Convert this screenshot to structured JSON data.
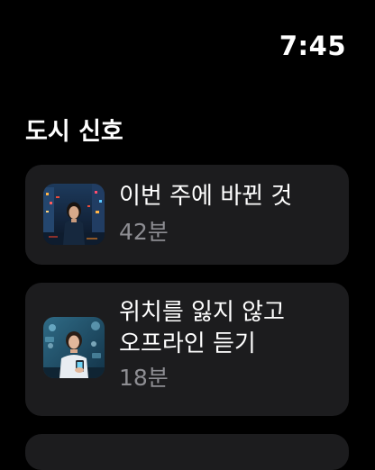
{
  "status_bar": {
    "time": "7:45"
  },
  "section": {
    "title": "도시 신호"
  },
  "episodes": [
    {
      "title_lines": [
        "이번 주에 바뀐 것"
      ],
      "duration": "42분",
      "thumbnail_icon": "city-night-person-image"
    },
    {
      "title_lines": [
        "위치를 잃지 않고",
        "오프라인 듣기"
      ],
      "duration": "18분",
      "thumbnail_icon": "person-with-phone-image"
    }
  ],
  "colors": {
    "background": "#000000",
    "card": "#1c1c1e",
    "primary_text": "#ffffff",
    "secondary_text": "#8e8e93"
  }
}
